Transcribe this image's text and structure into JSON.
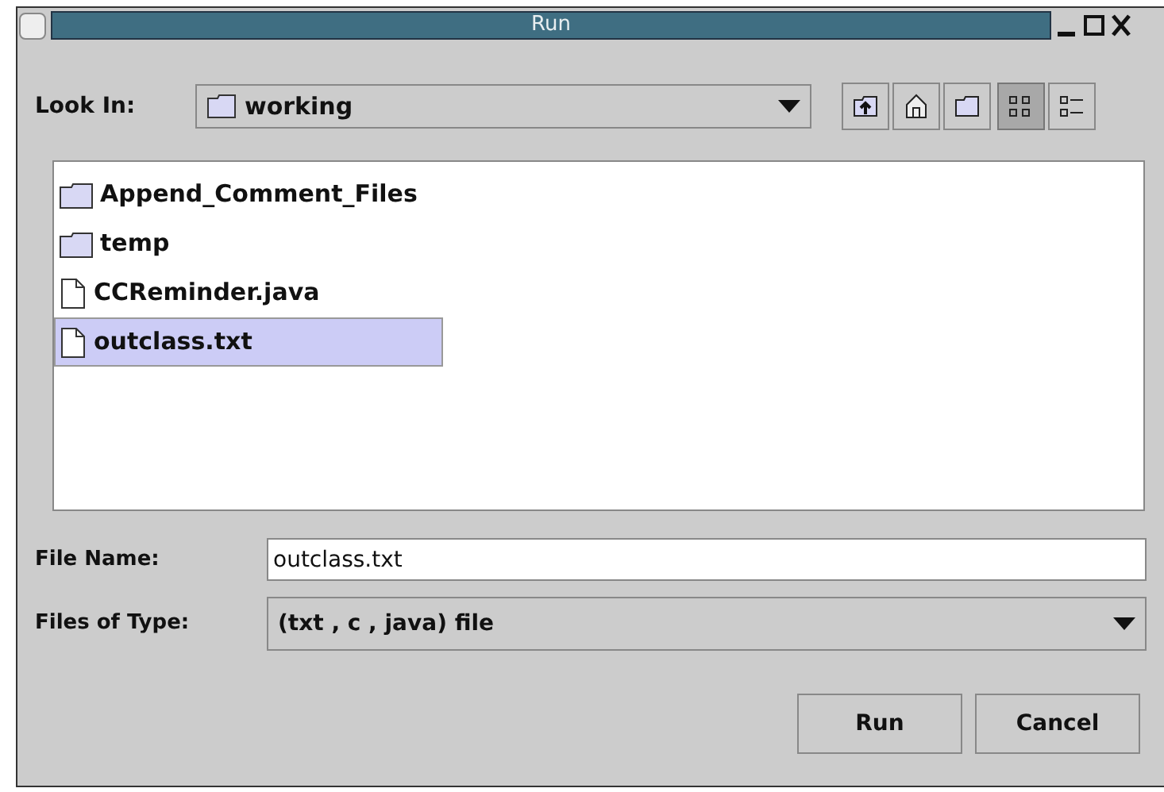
{
  "window": {
    "title": "Run"
  },
  "look_in": {
    "label": "Look In:",
    "value": "working"
  },
  "toolbar": [
    {
      "kind": "up",
      "selected": false
    },
    {
      "kind": "home",
      "selected": false
    },
    {
      "kind": "new-folder",
      "selected": false
    },
    {
      "kind": "list",
      "selected": true
    },
    {
      "kind": "details",
      "selected": false
    }
  ],
  "files": [
    {
      "name": "Append_Comment_Files",
      "kind": "folder",
      "selected": false
    },
    {
      "name": "temp",
      "kind": "folder",
      "selected": false
    },
    {
      "name": "CCReminder.java",
      "kind": "file",
      "selected": false
    },
    {
      "name": "outclass.txt",
      "kind": "file",
      "selected": true
    }
  ],
  "file_name": {
    "label": "File Name:",
    "value": "outclass.txt"
  },
  "file_type": {
    "label": "Files of Type:",
    "value": "(txt , c , java) file"
  },
  "buttons": [
    "Run",
    "Cancel"
  ]
}
